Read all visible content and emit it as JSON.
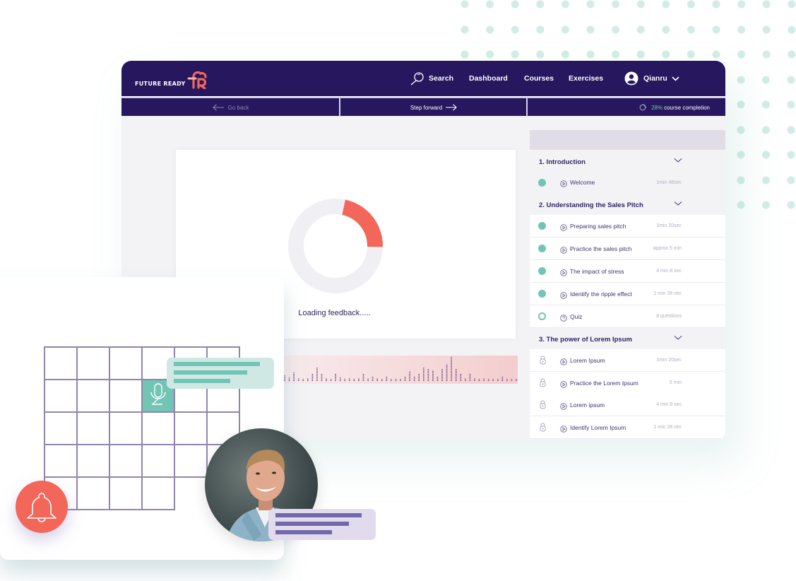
{
  "app": {
    "brand": "FUTURE READY",
    "brand_mark": "fR"
  },
  "nav": {
    "search": "Search",
    "dashboard": "Dashboard",
    "courses": "Courses",
    "exercises": "Exercises",
    "user": "Qianru"
  },
  "subnav": {
    "back": "Go back",
    "forward": "Step forward",
    "completion_percent": "28%",
    "completion_label": "course completion",
    "completion_value": 0.28
  },
  "main": {
    "loading_text": "Loading feedback.....",
    "loading_progress": 0.22
  },
  "sidebar": {
    "sections": [
      {
        "title": "1. Introduction",
        "items": [
          {
            "label": "Welcome",
            "meta": "1min 48sec",
            "status": "done",
            "type": "video"
          }
        ]
      },
      {
        "title": "2. Understanding the Sales Pitch",
        "items": [
          {
            "label": "Preparing sales pitch",
            "meta": "1min 20sec",
            "status": "done",
            "type": "video"
          },
          {
            "label": "Practice the sales pitch",
            "meta": "approx 5 min",
            "status": "done",
            "type": "video"
          },
          {
            "label": "The impact of stress",
            "meta": "4 min 8 sec",
            "status": "done",
            "type": "video"
          },
          {
            "label": "Identify the ripple effect",
            "meta": "1 min 28 sec",
            "status": "done",
            "type": "video"
          },
          {
            "label": "Quiz",
            "meta": "8 questions",
            "status": "open",
            "type": "quiz"
          }
        ]
      },
      {
        "title": "3. The power of Lorem Ipsum",
        "items": [
          {
            "label": "Lorem Ipsum",
            "meta": "1min 20sec",
            "status": "locked",
            "type": "video"
          },
          {
            "label": "Practice the Lorem Ipsum",
            "meta": "5 min",
            "status": "locked",
            "type": "video"
          },
          {
            "label": "Lorem ipsum",
            "meta": "4 min 8 sec",
            "status": "locked",
            "type": "video"
          },
          {
            "label": "Identify Lorem Ipsum",
            "meta": "1 min 28 sec",
            "status": "locked",
            "type": "video"
          }
        ]
      }
    ]
  },
  "icons": {
    "search": "search-icon",
    "user": "user-circle-icon",
    "chevron": "chevron-down-icon",
    "back": "arrow-left-icon",
    "forward": "arrow-right-icon",
    "progress": "progress-ring-icon",
    "play": "play-circle-icon",
    "quiz": "question-circle-icon",
    "lock": "lock-icon",
    "mic": "microphone-icon",
    "bell": "bell-icon"
  },
  "colors": {
    "navy": "#26175f",
    "teal": "#72c4b4",
    "coral": "#f2675a",
    "lilac": "#7269aa",
    "panel": "#f3f3f6"
  },
  "waveform": [
    0.25,
    0.15,
    0.35,
    0.12,
    0.08,
    0.12,
    0.3,
    0.55,
    0.3,
    0.12,
    0.08,
    0.3,
    0.15,
    0.05,
    0.12,
    0.05,
    0.12,
    0.3,
    0.12,
    0.2,
    0.12,
    0.08,
    0.2,
    0.08,
    0.08,
    0.05,
    0.2,
    0.4,
    0.2,
    0.3,
    0.55,
    0.5,
    0.45,
    0.2,
    0.5,
    0.7,
    1.0,
    0.5,
    0.3,
    0.12,
    0.3,
    0.12,
    0.05,
    0.12,
    0.05,
    0.08,
    0.05,
    0.2,
    0.08,
    0.08,
    0.05
  ]
}
